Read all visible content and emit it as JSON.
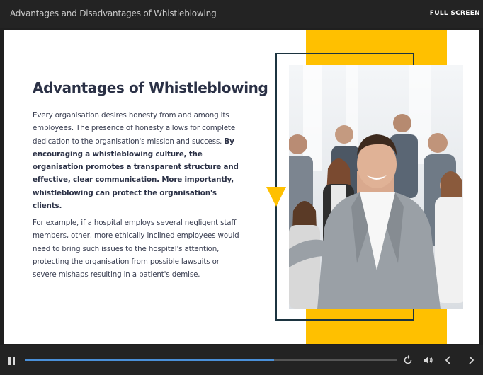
{
  "header": {
    "course_title": "Advantages and Disadvantages of Whistleblowing",
    "fullscreen_label": "FULL SCREEN"
  },
  "slide": {
    "title": "Advantages of Whistleblowing",
    "paragraph1_normal": "Every organisation desires honesty from and among its employees. The presence of honesty allows for complete dedication to the organisation's mission and success.",
    "paragraph1_bold": "By encouraging a whistleblowing culture, the organisation promotes a transparent structure and effective, clear communication. More importantly, whistleblowing can protect the organisation's clients.",
    "paragraph2": "For example, if a hospital employs several negligent staff members, other, more ethically inclined employees would need to bring such issues to the hospital's attention, protecting the organisation from possible lawsuits or severe mishaps resulting in a patient's demise."
  },
  "player": {
    "progress": 0.67,
    "icons": [
      "pause-icon",
      "replay-icon",
      "volume-icon",
      "previous-icon",
      "next-icon"
    ]
  },
  "colors": {
    "accent": "#ffc000",
    "frame": "#1c3440",
    "progress": "#4a90d9"
  }
}
